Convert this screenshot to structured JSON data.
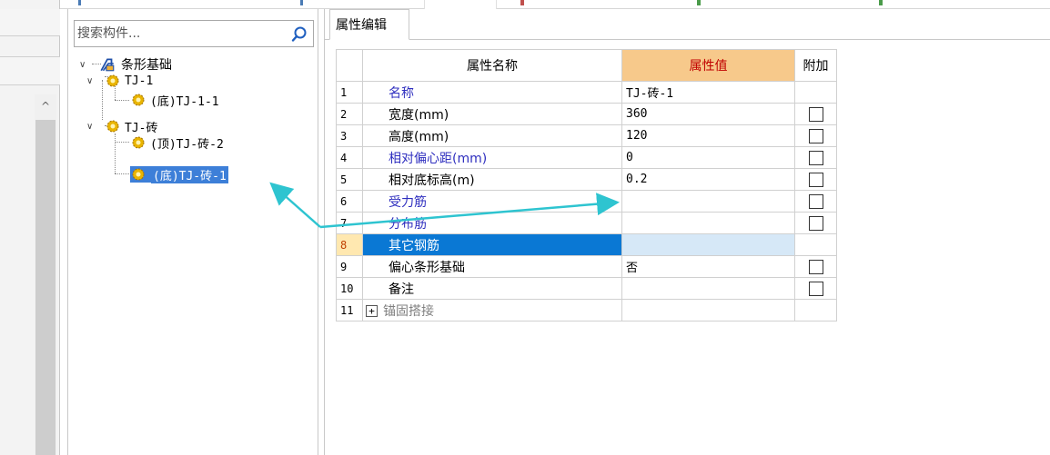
{
  "search": {
    "placeholder": "搜索构件..."
  },
  "tree": {
    "root": "条形基础",
    "items": [
      {
        "label": "TJ-1"
      },
      {
        "label": "(底)TJ-1-1"
      },
      {
        "label": "TJ-砖"
      },
      {
        "label": "(顶)TJ-砖-2"
      },
      {
        "label": "(底)TJ-砖-1"
      }
    ]
  },
  "property_panel": {
    "tab": "属性编辑",
    "headers": {
      "name": "属性名称",
      "value": "属性值",
      "extra": "附加"
    },
    "rows": [
      {
        "num": "1",
        "name": "名称",
        "value": "TJ-砖-1",
        "checkbox": false
      },
      {
        "num": "2",
        "name": "宽度(mm)",
        "value": "360",
        "checkbox": true
      },
      {
        "num": "3",
        "name": "高度(mm)",
        "value": "120",
        "checkbox": true
      },
      {
        "num": "4",
        "name": "相对偏心距(mm)",
        "value": "0",
        "checkbox": true
      },
      {
        "num": "5",
        "name": "相对底标高(m)",
        "value": "0.2",
        "checkbox": true
      },
      {
        "num": "6",
        "name": "受力筋",
        "value": "",
        "checkbox": true
      },
      {
        "num": "7",
        "name": "分布筋",
        "value": "",
        "checkbox": true
      },
      {
        "num": "8",
        "name": "其它钢筋",
        "value": "",
        "checkbox": false
      },
      {
        "num": "9",
        "name": "偏心条形基础",
        "value": "否",
        "checkbox": true
      },
      {
        "num": "10",
        "name": "备注",
        "value": "",
        "checkbox": true
      },
      {
        "num": "11",
        "name": "锚固搭接",
        "value": "",
        "checkbox": false
      }
    ]
  },
  "colors": {
    "selection": "#0a78d4",
    "value_header": "#f7c98b",
    "value_header_text": "#c00000",
    "link_text": "#2f2fbf",
    "annotation_arrow": "#2ec4d0"
  }
}
